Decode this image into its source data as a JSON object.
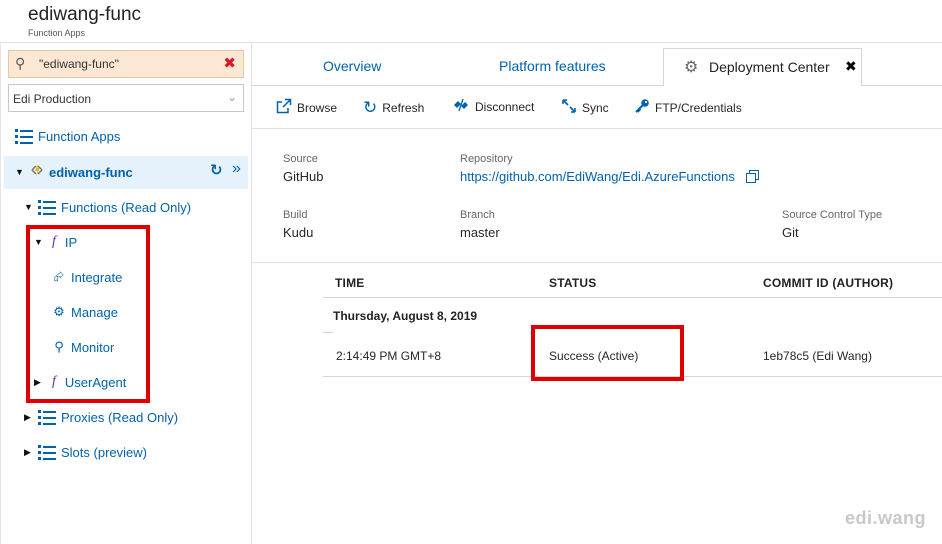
{
  "header": {
    "title": "ediwang-func",
    "subtitle": "Function Apps"
  },
  "sidebar": {
    "search": {
      "value": "\"ediwang-func\"",
      "icon": "search-icon",
      "clear_icon": "close-icon"
    },
    "subscription": {
      "selected": "Edi Production"
    },
    "tree": {
      "function_apps": "Function Apps",
      "app": "ediwang-func",
      "functions": "Functions (Read Only)",
      "ip": "IP",
      "integrate": "Integrate",
      "manage": "Manage",
      "monitor": "Monitor",
      "useragent": "UserAgent",
      "proxies": "Proxies (Read Only)",
      "slots": "Slots (preview)"
    }
  },
  "tabs": {
    "overview": "Overview",
    "platform": "Platform features",
    "deployment": "Deployment Center"
  },
  "toolbar": {
    "browse": "Browse",
    "refresh": "Refresh",
    "disconnect": "Disconnect",
    "sync": "Sync",
    "ftp": "FTP/Credentials"
  },
  "info": {
    "source_label": "Source",
    "source_value": "GitHub",
    "repo_label": "Repository",
    "repo_value": "https://github.com/EdiWang/Edi.AzureFunctions",
    "build_label": "Build",
    "build_value": "Kudu",
    "branch_label": "Branch",
    "branch_value": "master",
    "sct_label": "Source Control Type",
    "sct_value": "Git"
  },
  "table": {
    "headers": {
      "time": "TIME",
      "status": "STATUS",
      "commit": "COMMIT ID (AUTHOR)"
    },
    "group_date": "Thursday, August 8, 2019",
    "rows": [
      {
        "time": "2:14:49 PM GMT+8",
        "status": "Success (Active)",
        "commit": "1eb78c5 (Edi Wang)"
      }
    ]
  },
  "watermark": "edi.wang",
  "colors": {
    "link": "#0062ad",
    "highlight": "#e00000",
    "search_bg": "#fce8d2",
    "function_icon": "#6b2c91"
  }
}
